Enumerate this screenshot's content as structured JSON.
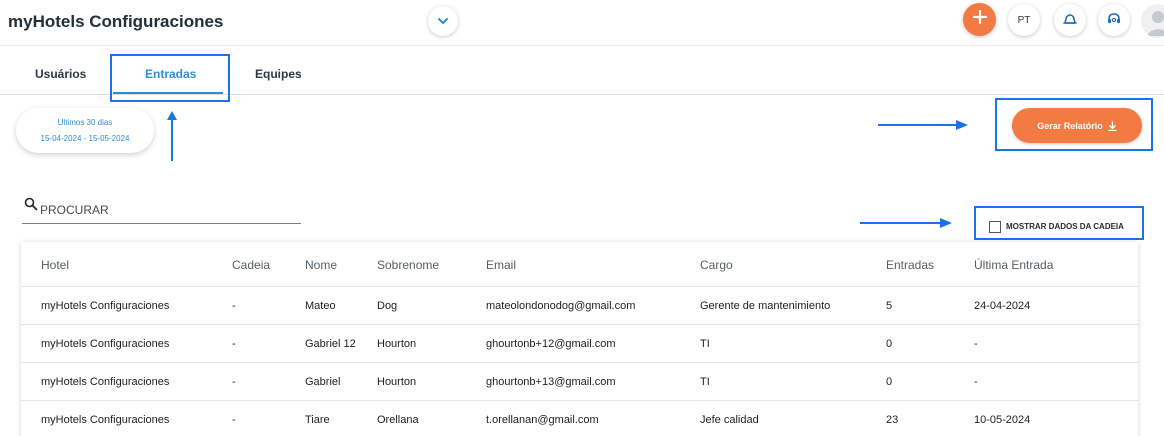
{
  "header": {
    "title": "myHotels Configuraciones",
    "user_initials": "PT"
  },
  "tabs": [
    {
      "label": "Usuários"
    },
    {
      "label": "Entradas"
    },
    {
      "label": "Equipes"
    }
  ],
  "date_filter": {
    "label": "Ultimos 30 dias",
    "range": "15-04-2024 - 15-05-2024"
  },
  "report": {
    "label": "Gerar Relatório"
  },
  "search": {
    "placeholder": "PROCURAR",
    "value": ""
  },
  "chain_toggle": {
    "label": "MOSTRAR DADOS DA CADEIA",
    "checked": false
  },
  "table": {
    "columns": [
      "Hotel",
      "Cadeia",
      "Nome",
      "Sobrenome",
      "Email",
      "Cargo",
      "Entradas",
      "Última Entrada"
    ],
    "rows": [
      [
        "myHotels Configuraciones",
        "-",
        "Mateo",
        "Dog",
        "mateolondonodog@gmail.com",
        "Gerente de mantenimiento",
        "5",
        "24-04-2024"
      ],
      [
        "myHotels Configuraciones",
        "-",
        "Gabriel 12",
        "Hourton",
        "ghourtonb+12@gmail.com",
        "TI",
        "0",
        "-"
      ],
      [
        "myHotels Configuraciones",
        "-",
        "Gabriel",
        "Hourton",
        "ghourtonb+13@gmail.com",
        "TI",
        "0",
        "-"
      ],
      [
        "myHotels Configuraciones",
        "-",
        "Tiare",
        "Orellana",
        "t.orellanan@gmail.com",
        "Jefe calidad",
        "23",
        "10-05-2024"
      ]
    ]
  },
  "colors": {
    "accent_orange": "#f47a43",
    "accent_blue": "#2c8fd6",
    "annotation_blue": "#1a73e8"
  }
}
